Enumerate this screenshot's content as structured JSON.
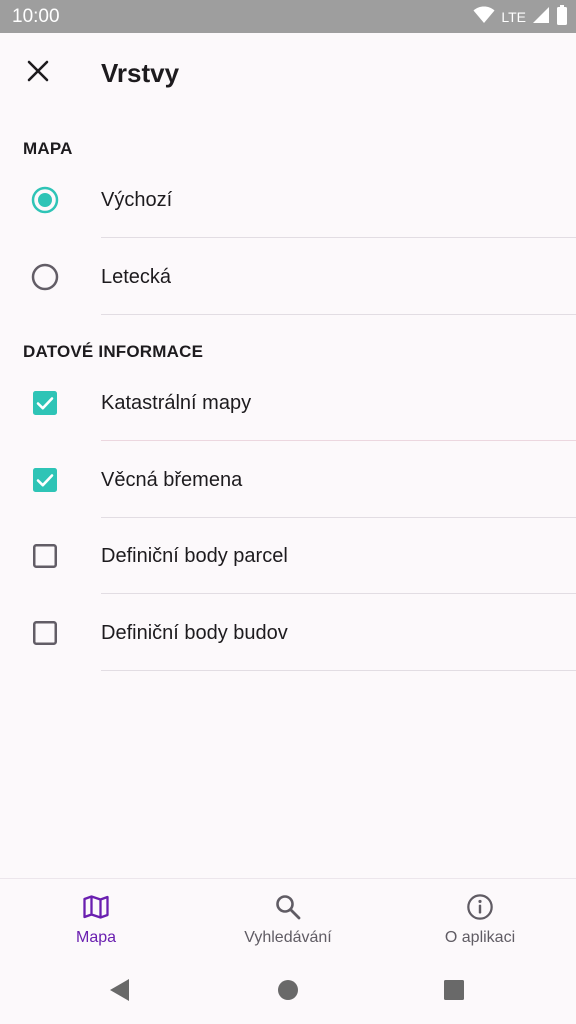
{
  "status_bar": {
    "time": "10:00",
    "network": "LTE",
    "icons": [
      "wifi-icon",
      "cell-signal-icon",
      "battery-icon"
    ]
  },
  "app_bar": {
    "title": "Vrstvy",
    "close_icon": "close-icon"
  },
  "sections": {
    "map": {
      "header": "MAPA",
      "options": [
        {
          "label": "Výchozí",
          "selected": true
        },
        {
          "label": "Letecká",
          "selected": false
        }
      ]
    },
    "data": {
      "header": "DATOVÉ INFORMACE",
      "options": [
        {
          "label": "Katastrální mapy",
          "checked": true
        },
        {
          "label": "Věcná břemena",
          "checked": true
        },
        {
          "label": "Definiční body parcel",
          "checked": false
        },
        {
          "label": "Definiční body budov",
          "checked": false
        }
      ]
    }
  },
  "bottom_nav": {
    "items": [
      {
        "label": "Mapa",
        "icon": "map-icon",
        "active": true
      },
      {
        "label": "Vyhledávání",
        "icon": "search-icon",
        "active": false
      },
      {
        "label": "O aplikaci",
        "icon": "info-icon",
        "active": false
      }
    ]
  },
  "system_nav": {
    "icons": [
      "back-icon",
      "home-icon",
      "recents-icon"
    ]
  },
  "colors": {
    "accent": "#2ec4b6",
    "nav_active": "#6a1fb0",
    "nav_inactive": "#605c64",
    "divider": "#e2dde3",
    "divider_accent": "#ecd7df",
    "status_bar": "#9e9e9e",
    "background": "#fcf9fb"
  }
}
